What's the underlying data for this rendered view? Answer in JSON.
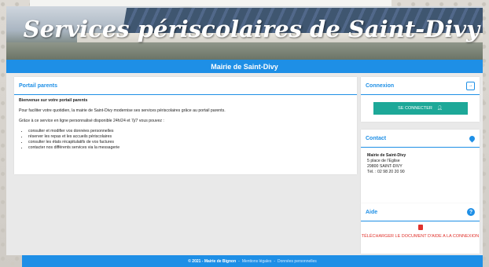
{
  "banner": {
    "title": "Services périscolaires de Saint-Divy"
  },
  "subheader": {
    "title": "Mairie de Saint-Divy"
  },
  "portal": {
    "title": "Portail parents",
    "welcome": "Bienvenue sur votre portail parents",
    "intro": "Pour faciliter votre quotidien, la mairie de Saint-Divy modernise ses services périscolaires grâce au portail parents.",
    "lead": "Grâce à ce service en ligne personnalisé disponible 24h/24 et 7j/7 vous pouvez :",
    "items": [
      "consulter et modifier vos données personnelles",
      "réserver les repas et les accueils périscolaires",
      "consulter les états récapitulatifs de vos factures",
      "contacter nos différents services via la messagerie"
    ]
  },
  "connexion": {
    "title": "Connexion",
    "button": "SE CONNECTER",
    "icon": "login-icon",
    "button_icon": "user-icon"
  },
  "contact": {
    "title": "Contact",
    "icon": "map-pin-icon",
    "org": "Mairie de Saint-Divy",
    "address1": "5 place de l'Eglise",
    "address2": "29800 SAINT-DIVY",
    "phone": "Tél. : 02 98 20 20 90"
  },
  "aide": {
    "title": "Aide",
    "icon": "help-icon",
    "link": "TÉLÉCHARGER LE DOCUMENT D'AIDE A LA CONNEXION"
  },
  "footer": {
    "copyright": "© 2021 - Mairie de Bignon",
    "sep": "-",
    "legal": "Mentions légales",
    "privacy": "Données personnelles"
  },
  "colors": {
    "accent": "#1e8fe6",
    "button": "#1da898",
    "link_red": "#e0322c"
  }
}
